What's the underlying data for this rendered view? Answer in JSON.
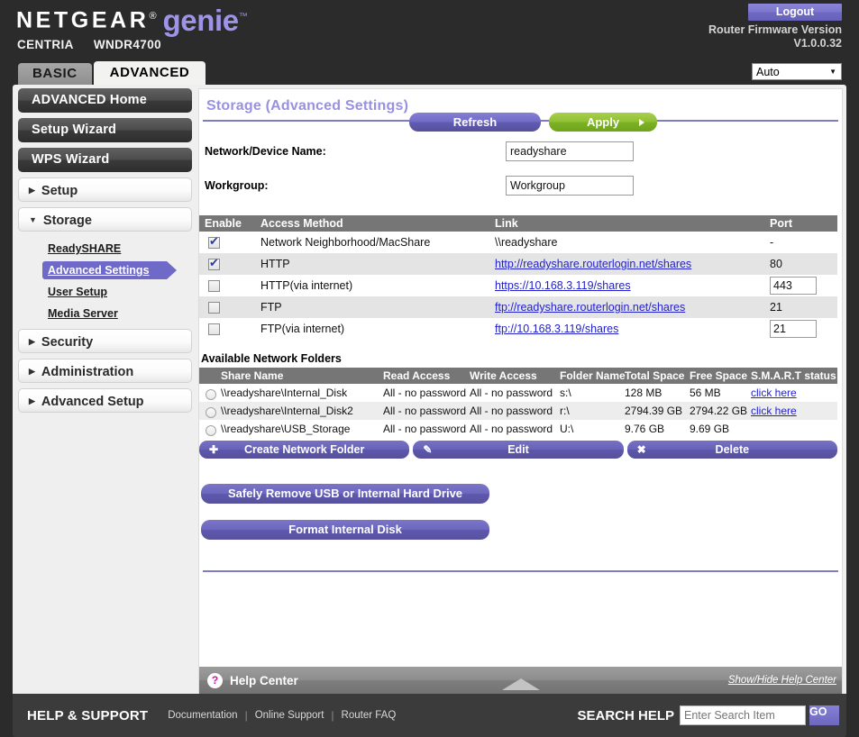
{
  "header": {
    "brand_netgear": "NETGEAR",
    "brand_reg": "®",
    "brand_genie": "genie",
    "brand_tm": "™",
    "model_prefix": "CENTRIA",
    "model_name": "WNDR4700",
    "logout_label": "Logout",
    "firmware_label": "Router Firmware Version",
    "firmware_version": "V1.0.0.32",
    "language_value": "Auto",
    "accent_purple": "#6f69c8",
    "accent_genie": "#9d94e8"
  },
  "tabs": [
    {
      "label": "BASIC",
      "active": false
    },
    {
      "label": "ADVANCED",
      "active": true
    }
  ],
  "sidebar": {
    "primary": [
      {
        "label": "ADVANCED Home",
        "style": "dark"
      },
      {
        "label": "Setup Wizard",
        "style": "dark"
      },
      {
        "label": "WPS Wizard",
        "style": "dark"
      }
    ],
    "groups": [
      {
        "label": "Setup",
        "expanded": false,
        "arrow": "▶"
      },
      {
        "label": "Storage",
        "expanded": true,
        "arrow": "▼"
      }
    ],
    "storage_children": [
      {
        "label": "ReadySHARE",
        "active": false
      },
      {
        "label": "Advanced Settings",
        "active": true
      },
      {
        "label": "User Setup",
        "active": false
      },
      {
        "label": "Media Server",
        "active": false
      }
    ],
    "trailing": [
      {
        "label": "Security",
        "arrow": "▶"
      },
      {
        "label": "Administration",
        "arrow": "▶"
      },
      {
        "label": "Advanced Setup",
        "arrow": "▶"
      }
    ]
  },
  "main": {
    "title": "Storage (Advanced Settings)",
    "refresh_label": "Refresh",
    "apply_label": "Apply",
    "fields": [
      {
        "label": "Network/Device Name:",
        "value": "readyshare"
      },
      {
        "label": "Workgroup:",
        "value": "Workgroup"
      }
    ],
    "access_table": {
      "columns": [
        "Enable",
        "Access Method",
        "Link",
        "Port"
      ],
      "rows": [
        {
          "enabled": true,
          "method": "Network Neighborhood/MacShare",
          "link": "\\\\readyshare",
          "is_link": false,
          "port": "-",
          "port_editable": false
        },
        {
          "enabled": true,
          "method": "HTTP",
          "link": "http://readyshare.routerlogin.net/shares",
          "is_link": true,
          "port": "80",
          "port_editable": false
        },
        {
          "enabled": false,
          "method": "HTTP(via internet)",
          "link": "https://10.168.3.119/shares",
          "is_link": true,
          "port": "443",
          "port_editable": true
        },
        {
          "enabled": false,
          "method": "FTP",
          "link": "ftp://readyshare.routerlogin.net/shares",
          "is_link": true,
          "port": "21",
          "port_editable": false
        },
        {
          "enabled": false,
          "method": "FTP(via internet)",
          "link": "ftp://10.168.3.119/shares",
          "is_link": true,
          "port": "21",
          "port_editable": true
        }
      ]
    },
    "folders_title": "Available Network Folders",
    "folders_table": {
      "columns": [
        "Share Name",
        "Read Access",
        "Write Access",
        "Folder Name",
        "Total Space",
        "Free Space",
        "S.M.A.R.T status"
      ],
      "rows": [
        {
          "selected": false,
          "share_name": "\\\\readyshare\\Internal_Disk",
          "read_access": "All - no password",
          "write_access": "All - no password",
          "folder_name": "s:\\",
          "total_space": "128 MB",
          "free_space": "56 MB",
          "smart": "click here",
          "has_smart": true
        },
        {
          "selected": false,
          "share_name": "\\\\readyshare\\Internal_Disk2",
          "read_access": "All - no password",
          "write_access": "All - no password",
          "folder_name": "r:\\",
          "total_space": "2794.39 GB",
          "free_space": "2794.22 GB",
          "smart": "click here",
          "has_smart": true
        },
        {
          "selected": false,
          "share_name": "\\\\readyshare\\USB_Storage",
          "read_access": "All - no password",
          "write_access": "All - no password",
          "folder_name": "U:\\",
          "total_space": "9.76 GB",
          "free_space": "9.69 GB",
          "smart": "",
          "has_smart": false
        }
      ]
    },
    "folder_buttons": [
      {
        "glyph": "➕",
        "icon": "plus-icon",
        "label": "Create Network Folder"
      },
      {
        "glyph": "✎",
        "icon": "pencil-icon",
        "label": "Edit"
      },
      {
        "glyph": "✖",
        "icon": "cross-icon",
        "label": "Delete"
      }
    ],
    "safely_remove_label": "Safely Remove USB or Internal Hard Drive",
    "format_disk_label": "Format Internal Disk"
  },
  "help_center": {
    "question_glyph": "?",
    "label": "Help Center",
    "show_hide_label": "Show/Hide Help Center"
  },
  "footer": {
    "title": "HELP & SUPPORT",
    "links": [
      "Documentation",
      "Online Support",
      "Router FAQ"
    ],
    "separator": "|",
    "search_title": "SEARCH HELP",
    "search_placeholder": "Enter Search Item",
    "search_value": "",
    "go_label": "GO"
  }
}
